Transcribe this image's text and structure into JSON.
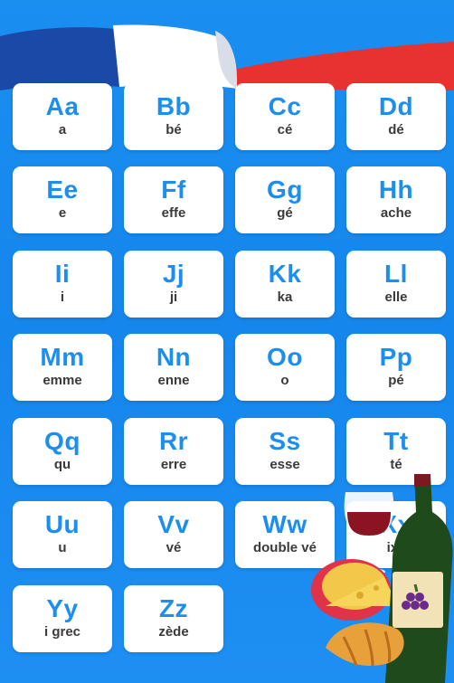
{
  "alphabet": [
    {
      "letter": "Aa",
      "name": "a"
    },
    {
      "letter": "Bb",
      "name": "bé"
    },
    {
      "letter": "Cc",
      "name": "cé"
    },
    {
      "letter": "Dd",
      "name": "dé"
    },
    {
      "letter": "Ee",
      "name": "e"
    },
    {
      "letter": "Ff",
      "name": "effe"
    },
    {
      "letter": "Gg",
      "name": "gé"
    },
    {
      "letter": "Hh",
      "name": "ache"
    },
    {
      "letter": "Ii",
      "name": "i"
    },
    {
      "letter": "Jj",
      "name": "ji"
    },
    {
      "letter": "Kk",
      "name": "ka"
    },
    {
      "letter": "Ll",
      "name": "elle"
    },
    {
      "letter": "Mm",
      "name": "emme"
    },
    {
      "letter": "Nn",
      "name": "enne"
    },
    {
      "letter": "Oo",
      "name": "o"
    },
    {
      "letter": "Pp",
      "name": "pé"
    },
    {
      "letter": "Qq",
      "name": "qu"
    },
    {
      "letter": "Rr",
      "name": "erre"
    },
    {
      "letter": "Ss",
      "name": "esse"
    },
    {
      "letter": "Tt",
      "name": "té"
    },
    {
      "letter": "Uu",
      "name": "u"
    },
    {
      "letter": "Vv",
      "name": "vé"
    },
    {
      "letter": "Ww",
      "name": "double vé"
    },
    {
      "letter": "Xx",
      "name": "ixe"
    },
    {
      "letter": "Yy",
      "name": "i grec"
    },
    {
      "letter": "Zz",
      "name": "zède"
    }
  ],
  "colors": {
    "background": "#1a8ff0",
    "letter": "#1b8ef0",
    "name": "#3a3a3a",
    "flag_blue": "#1a4aa8",
    "flag_white": "#ffffff",
    "flag_red": "#e8322f"
  }
}
